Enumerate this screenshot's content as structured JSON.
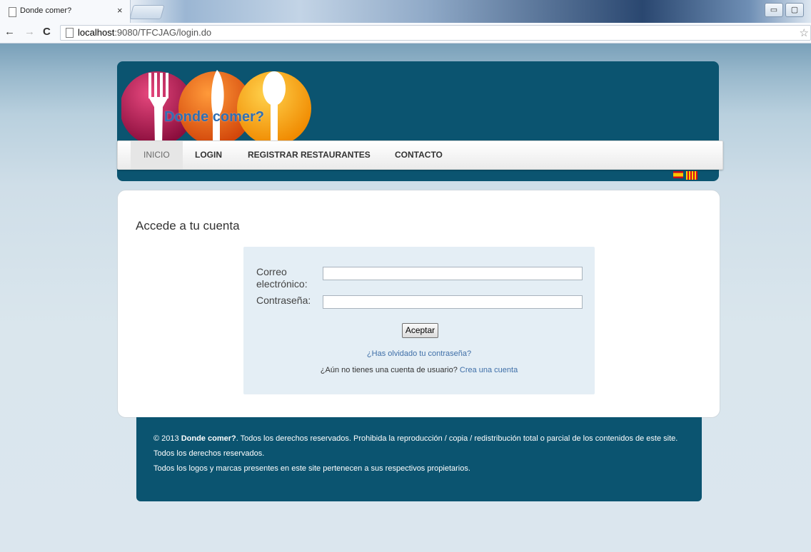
{
  "browser": {
    "tab_title": "Donde comer?",
    "tab_close": "×",
    "url_host": "localhost",
    "url_rest": ":9080/TFCJAG/login.do"
  },
  "site": {
    "logo_text": "Donde comer?",
    "nav": [
      {
        "label": "INICIO",
        "active": true
      },
      {
        "label": "LOGIN"
      },
      {
        "label": "REGISTRAR RESTAURANTES"
      },
      {
        "label": "CONTACTO"
      }
    ]
  },
  "login": {
    "heading": "Accede a tu cuenta",
    "email_label_1": "Correo",
    "email_label_2": "electrónico:",
    "email_value": "",
    "password_label": "Contraseña:",
    "password_value": "",
    "submit_label": "Aceptar",
    "forgot_link": "¿Has olvidado tu contraseña?",
    "no_account_text": "¿Aún no tienes una cuenta de usuario?",
    "create_account_link": "Crea una cuenta"
  },
  "footer": {
    "copyright_prefix": "© 2013",
    "brand": "Donde comer?",
    "line1_rest": ". Todos los derechos reservados. Prohibida la reproducción / copia / redistribución total o parcial de los contenidos de este site. Todos los derechos reservados.",
    "line2": "Todos los logos y marcas presentes en este site pertenecen a sus respectivos propietarios."
  },
  "colors": {
    "header_bg": "#0b5470",
    "link": "#3f6fa8",
    "login_box_bg": "#e4eef5"
  }
}
